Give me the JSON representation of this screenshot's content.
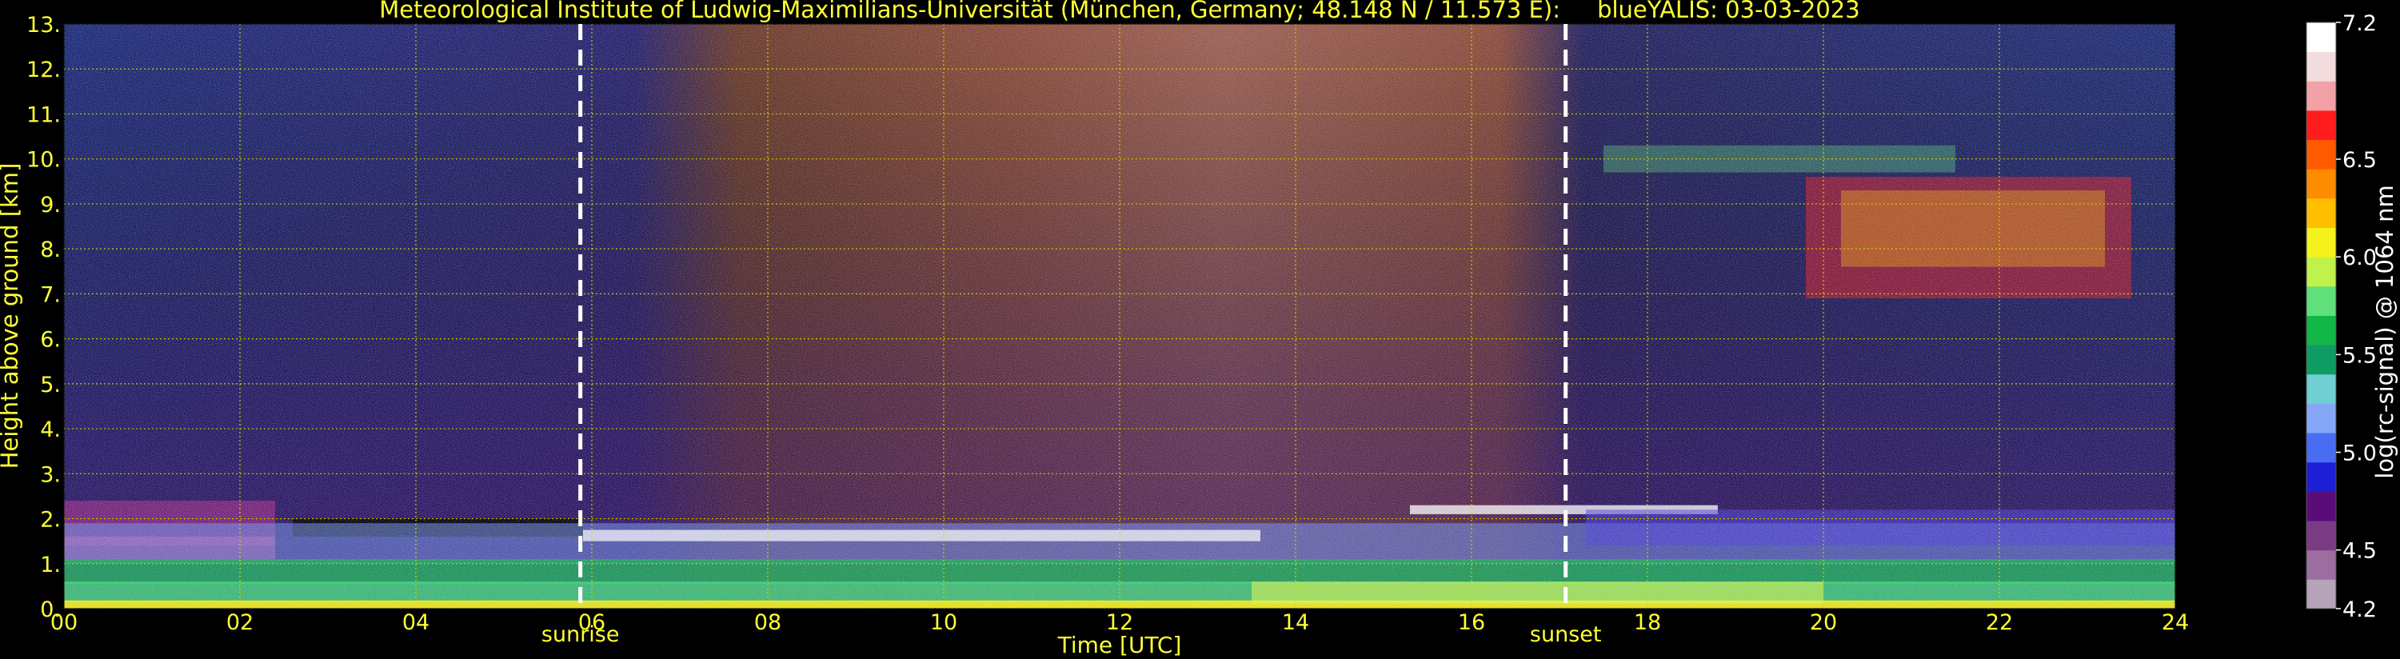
{
  "chart_data": {
    "type": "heatmap",
    "title": "Meteorological Institute of Ludwig-Maximilians-Universität (München, Germany; 48.148 N / 11.573 E):     blueYALIS: 03-03-2023",
    "xlabel": "Time [UTC]",
    "ylabel": "Height above ground [km]",
    "xlim": [
      0,
      24
    ],
    "ylim": [
      0,
      13
    ],
    "x_ticks": [
      "00",
      "02",
      "04",
      "06",
      "08",
      "10",
      "12",
      "14",
      "16",
      "18",
      "20",
      "22",
      "24"
    ],
    "x_tick_values": [
      0,
      2,
      4,
      6,
      8,
      10,
      12,
      14,
      16,
      18,
      20,
      22,
      24
    ],
    "y_ticks": [
      "0.",
      "1.",
      "2.",
      "3.",
      "4.",
      "5.",
      "6.",
      "7.",
      "8.",
      "9.",
      "10.",
      "11.",
      "12.",
      "13."
    ],
    "y_tick_values": [
      0,
      1,
      2,
      3,
      4,
      5,
      6,
      7,
      8,
      9,
      10,
      11,
      12,
      13
    ],
    "grid": true,
    "colorbar": {
      "label": "log(rc-signal) @ 1064 nm",
      "range": [
        4.2,
        7.2
      ],
      "tick_labels": [
        "4.2",
        "4.5",
        "5.0",
        "5.5",
        "6.0",
        "6.5",
        "7.2"
      ],
      "tick_values": [
        4.2,
        4.5,
        5.0,
        5.5,
        6.0,
        6.5,
        7.2
      ],
      "colors": [
        "#b5a3b8",
        "#9c6ea0",
        "#7a3b84",
        "#5a0d79",
        "#1f1fd6",
        "#4a6cf3",
        "#86a6f6",
        "#6fcfd3",
        "#0f9b63",
        "#12b548",
        "#5fe07a",
        "#bff24a",
        "#f4f21a",
        "#ffbf00",
        "#ff8c00",
        "#ff5a00",
        "#ff1c1c",
        "#f2a2a6",
        "#f3dcdd",
        "#ffffff"
      ]
    },
    "markers": [
      {
        "label": "sunrise",
        "x": 5.87
      },
      {
        "label": "sunset",
        "x": 17.07
      }
    ]
  },
  "colors": {
    "text": "#ffff33",
    "grid": "#d8d800",
    "marker_line": "#ffffff",
    "colorbar_text": "#ffffff"
  }
}
